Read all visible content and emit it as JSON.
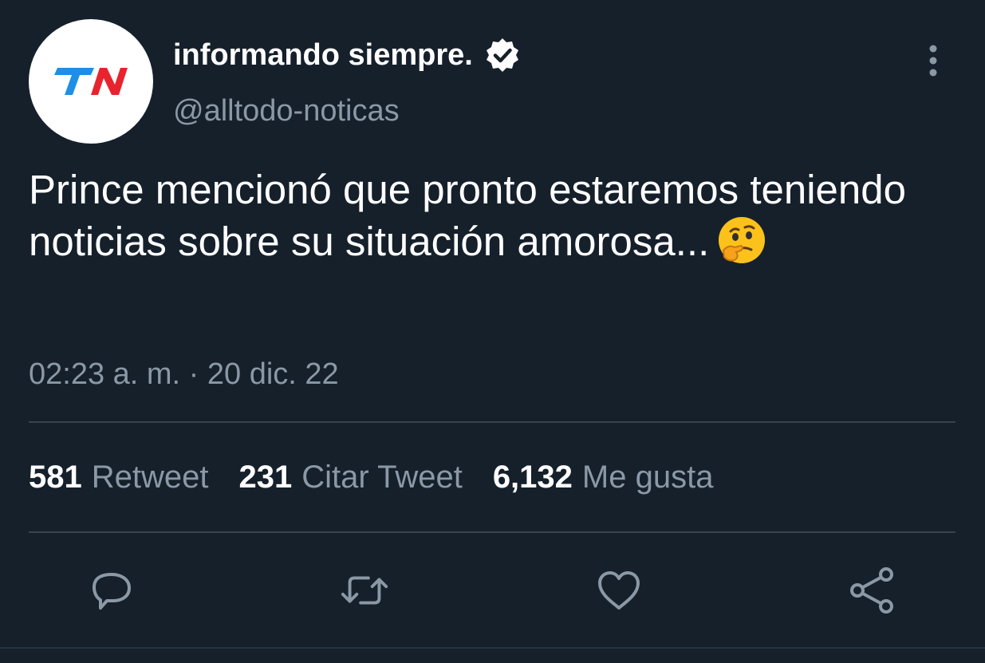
{
  "account": {
    "display_name": "informando siempre.",
    "handle": "@alltodo-noticas",
    "avatar_text": "TN"
  },
  "tweet": {
    "text": "Prince mencionó que pronto estaremos teniendo noticias sobre su situación amorosa...",
    "emoji": "thinking-face",
    "timestamp": "02:23 a. m. · 20 dic. 22"
  },
  "stats": {
    "retweets_count": "581",
    "retweets_label": "Retweet",
    "quotes_count": "231",
    "quotes_label": "Citar Tweet",
    "likes_count": "6,132",
    "likes_label": "Me gusta"
  },
  "actions": [
    "reply-icon",
    "retweet-icon",
    "like-icon",
    "share-icon"
  ],
  "colors": {
    "background": "#15202b",
    "text_primary": "#ffffff",
    "text_secondary": "#8b98a5",
    "divider": "#38444d",
    "tn_blue": "#1e8ee6",
    "tn_red": "#e8232e"
  }
}
